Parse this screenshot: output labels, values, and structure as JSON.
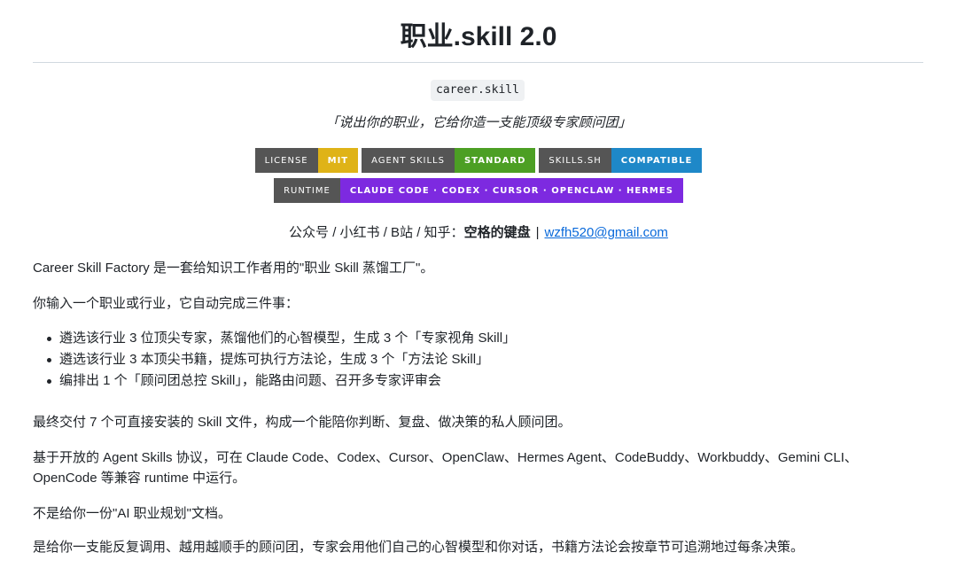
{
  "header": {
    "title": "职业.skill 2.0",
    "code_chip": "career.skill",
    "tagline": "「说出你的职业，它给你造一支能顶级专家顾问团」"
  },
  "badges": {
    "row1": [
      {
        "label": "LICENSE",
        "message": "MIT",
        "color": "#dfb317"
      },
      {
        "label": "AGENT SKILLS",
        "message": "STANDARD",
        "color": "#4c9f24"
      },
      {
        "label": "SKILLS.SH",
        "message": "COMPATIBLE",
        "color": "#1e88c8"
      }
    ],
    "row2": [
      {
        "label": "RUNTIME",
        "message": "CLAUDE CODE · CODEX · CURSOR · OPENCLAW · HERMES",
        "color": "#7d2ae0"
      }
    ]
  },
  "contact": {
    "prefix": "公众号 / 小红书 / B站 / 知乎：",
    "name": "空格的键盘",
    "separator": "|",
    "email": "wzfh520@gmail.com"
  },
  "body": {
    "p1": "Career Skill Factory 是一套给知识工作者用的\"职业 Skill 蒸馏工厂\"。",
    "p2": "你输入一个职业或行业，它自动完成三件事：",
    "bullets": [
      "遴选该行业 3 位顶尖专家，蒸馏他们的心智模型，生成 3 个「专家视角 Skill」",
      "遴选该行业 3 本顶尖书籍，提炼可执行方法论，生成 3 个「方法论 Skill」",
      "编排出 1 个「顾问团总控 Skill」，能路由问题、召开多专家评审会"
    ],
    "p3": "最终交付 7 个可直接安装的 Skill 文件，构成一个能陪你判断、复盘、做决策的私人顾问团。",
    "p4a": "基于开放的 Agent Skills 协议，可在 Claude Code、Codex、Cursor、OpenClaw、Hermes Agent、CodeBuddy、Workbuddy、Gemini CLI、",
    "p4b": "OpenCode 等兼容 runtime 中运行。",
    "p5": "不是给你一份\"AI 职业规划\"文档。",
    "p6": "是给你一支能反复调用、越用越顺手的顾问团，专家会用他们自己的心智模型和你对话，书籍方法论会按章节可追溯地过每条决策。"
  }
}
